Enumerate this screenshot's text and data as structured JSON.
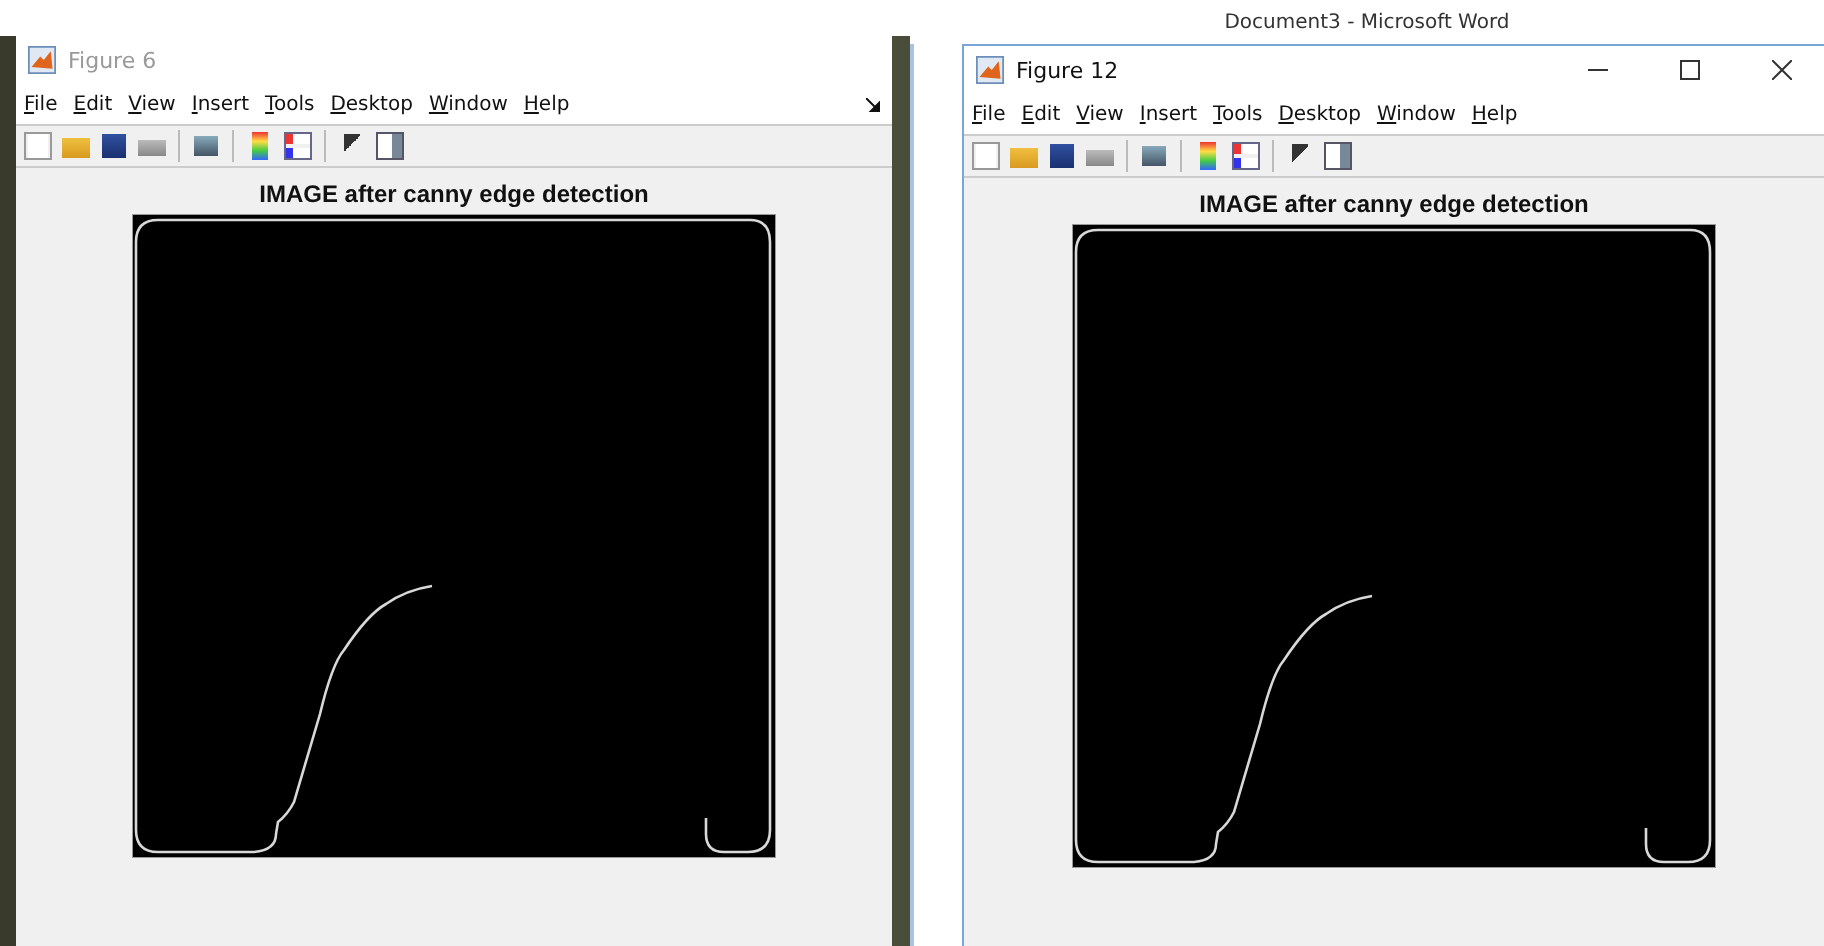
{
  "host_window": {
    "title": "Document3 - Microsoft Word"
  },
  "figures": [
    {
      "title": "Figure 6",
      "active": false,
      "caption_buttons": false,
      "menu": [
        "File",
        "Edit",
        "View",
        "Insert",
        "Tools",
        "Desktop",
        "Window",
        "Help"
      ],
      "axes_title": "IMAGE after canny edge detection"
    },
    {
      "title": "Figure 12",
      "active": true,
      "caption_buttons": true,
      "menu": [
        "File",
        "Edit",
        "View",
        "Insert",
        "Tools",
        "Desktop",
        "Window",
        "Help"
      ],
      "axes_title": "IMAGE after canny edge detection"
    }
  ]
}
